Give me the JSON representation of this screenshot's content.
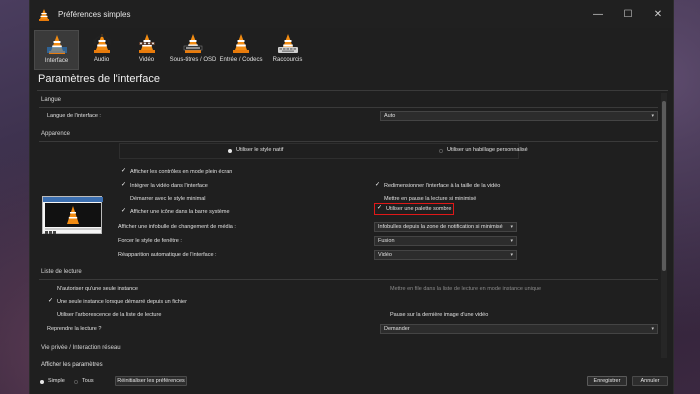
{
  "window": {
    "title": "Préférences simples",
    "controls": {
      "minimize": "—",
      "maximize": "☐",
      "close": "✕"
    }
  },
  "toolbar": {
    "items": [
      {
        "label": "Interface"
      },
      {
        "label": "Audio"
      },
      {
        "label": "Vidéo"
      },
      {
        "label": "Sous-titres / OSD"
      },
      {
        "label": "Entrée / Codecs"
      },
      {
        "label": "Raccourcis"
      }
    ]
  },
  "page_title": "Paramètres de l'interface",
  "langue": {
    "section": "Langue",
    "label": "Langue de l'interface :",
    "value": "Auto"
  },
  "apparence": {
    "section": "Apparence",
    "native_style": "Utiliser le style natif",
    "custom_skin": "Utiliser un habillage personnalisé",
    "checks": {
      "fullscreen_controls": "Afficher les contrôles en mode plein écran",
      "integrate_video": "Intégrer la vidéo dans l'interface",
      "minimal_start": "Démarrer avec le style minimal",
      "systray_icon": "Afficher une icône dans la barre système",
      "resize_interface": "Redimensionner l'interface à la taille de la vidéo",
      "pause_minimized": "Mettre en pause la lecture si minimisé",
      "dark_palette": "Utiliser une palette sombre"
    },
    "popup_label": "Afficher une infobulle de changement de média :",
    "popup_value": "Infobulles depuis la zone de notification si minimisé",
    "window_style_label": "Forcer le style de fenêtre :",
    "window_style_value": "Fusion",
    "auto_raise_label": "Réapparition automatique de l'interface :",
    "auto_raise_value": "Vidéo"
  },
  "playlist": {
    "section": "Liste de lecture",
    "one_instance": "N'autoriser qu'une seule instance",
    "enqueue_instance": "Mettre en file dans la liste de lecture en mode instance unique",
    "one_instance_file": "Une seule instance lorsque démarré depuis un fichier",
    "playlist_tree": "Utiliser l'arborescence de la liste de lecture",
    "pause_last_frame": "Pause sur la dernière image d'une vidéo",
    "resume_label": "Reprendre la lecture ?",
    "resume_value": "Demander"
  },
  "privacy": {
    "section": "Vie privée / Interaction réseau"
  },
  "footer": {
    "show_settings": "Afficher les paramètres",
    "simple": "Simple",
    "all": "Tous",
    "reset": "Réinitialiser les préférences",
    "save": "Enregistrer",
    "cancel": "Annuler"
  },
  "colors": {
    "accent_highlight": "#e01818",
    "window_bg": "#1f1f1f"
  }
}
